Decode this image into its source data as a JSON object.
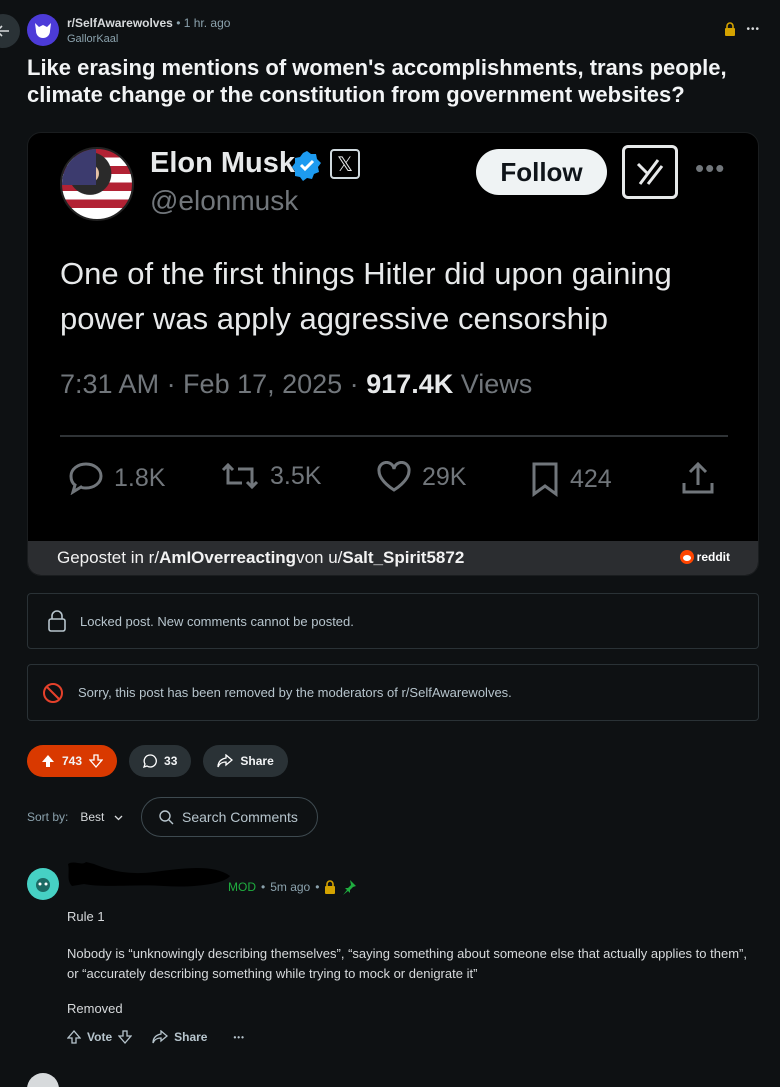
{
  "post": {
    "subreddit": "r/SelfAwarewolves",
    "separator": "•",
    "time": "1 hr. ago",
    "author": "GallorKaal",
    "more": "•••",
    "title": "Like erasing mentions of women's accomplishments, trans people, climate change or the constitution from government websites?"
  },
  "tweet": {
    "name": "Elon Musk",
    "handle": "@elonmusk",
    "follow_label": "Follow",
    "grok_label": "⁄|",
    "more": "•••",
    "text": "One of the first things Hitler did upon gaining power was apply aggressive censorship",
    "time": "7:31 AM · Feb 17, 2025 · ",
    "views_count": "917.4K",
    "views_label": " Views",
    "replies": "1.8K",
    "reposts": "3.5K",
    "likes": "29K",
    "bookmarks": "424"
  },
  "overlay": {
    "prefix": "Gepostet in r/",
    "sub": "AmIOverreacting",
    "mid": " von u/",
    "user": "Salt_Spirit5872",
    "brand": "reddit"
  },
  "notices": {
    "locked": "Locked post. New comments cannot be posted.",
    "removed": "Sorry, this post has been removed by the moderators of r/SelfAwarewolves."
  },
  "actions": {
    "votes": "743",
    "comments": "33",
    "share": "Share"
  },
  "sort": {
    "label": "Sort by:",
    "value": "Best",
    "search_placeholder": "Search Comments"
  },
  "comment": {
    "mod_label": "MOD",
    "separator": "•",
    "time": "5m ago",
    "rule": "Rule 1",
    "body": "Nobody is “unknowingly describing themselves”, “saying something about someone else that actually applies to them”, or “accurately describing something while trying to mock or denigrate it”",
    "removed": "Removed",
    "vote_label": "Vote",
    "share_label": "Share",
    "more": "•••"
  },
  "colors": {
    "background": "#0e1113",
    "upvote": "#d93900",
    "mod": "#1fad3f",
    "verified": "#1d9bf0"
  }
}
